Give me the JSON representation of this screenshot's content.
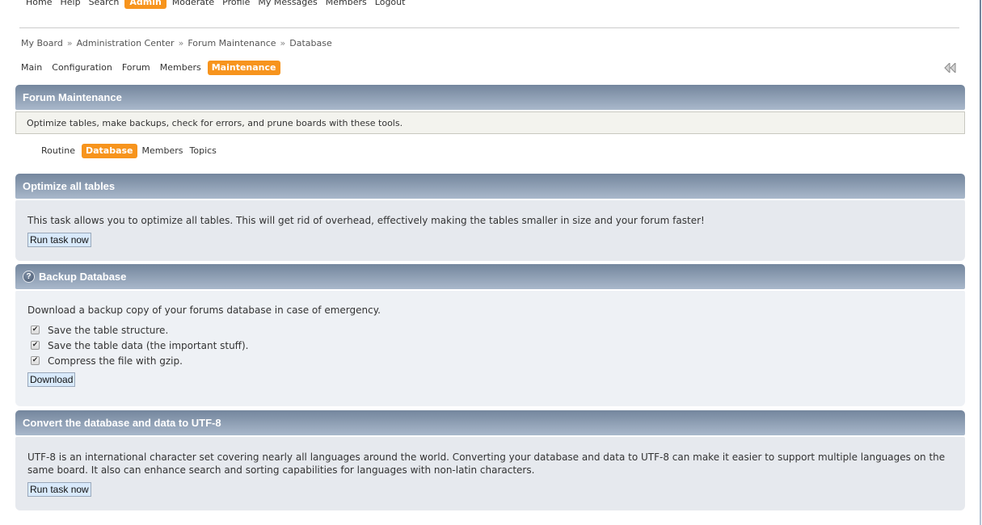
{
  "top_nav": {
    "items": [
      {
        "label": "Home",
        "active": false
      },
      {
        "label": "Help",
        "active": false
      },
      {
        "label": "Search",
        "active": false
      },
      {
        "label": "Admin",
        "active": true
      },
      {
        "label": "Moderate",
        "active": false
      },
      {
        "label": "Profile",
        "active": false
      },
      {
        "label": "My Messages",
        "active": false
      },
      {
        "label": "Members",
        "active": false
      },
      {
        "label": "Logout",
        "active": false
      }
    ]
  },
  "breadcrumb": {
    "separator": "»",
    "items": [
      "My Board",
      "Administration Center",
      "Forum Maintenance",
      "Database"
    ]
  },
  "admin_nav": {
    "items": [
      {
        "label": "Main",
        "active": false
      },
      {
        "label": "Configuration",
        "active": false
      },
      {
        "label": "Forum",
        "active": false
      },
      {
        "label": "Members",
        "active": false
      },
      {
        "label": "Maintenance",
        "active": true
      }
    ],
    "collapse_icon": "double-chevron-left-icon"
  },
  "section": {
    "title": "Forum Maintenance",
    "description": "Optimize tables, make backups, check for errors, and prune boards with these tools.",
    "tabs": [
      {
        "label": "Routine",
        "active": false
      },
      {
        "label": "Database",
        "active": true
      },
      {
        "label": "Members",
        "active": false
      },
      {
        "label": "Topics",
        "active": false
      }
    ]
  },
  "panels": {
    "optimize": {
      "title": "Optimize all tables",
      "text": "This task allows you to optimize all tables. This will get rid of overhead, effectively making the tables smaller in size and your forum faster!",
      "button": "Run task now"
    },
    "backup": {
      "title": "Backup Database",
      "help_icon": "?",
      "text": "Download a backup copy of your forums database in case of emergency.",
      "options": [
        {
          "label": "Save the table structure.",
          "checked": true
        },
        {
          "label": "Save the table data (the important stuff).",
          "checked": true
        },
        {
          "label": "Compress the file with gzip.",
          "checked": true
        }
      ],
      "button": "Download"
    },
    "utf8": {
      "title": "Convert the database and data to UTF-8",
      "text": "UTF-8 is an international character set covering nearly all languages around the world. Converting your database and data to UTF-8 can make it easier to support multiple languages on the same board. It also can enhance search and sorting capabilities for languages with non-latin characters.",
      "button": "Run task now"
    }
  },
  "colors": {
    "accent": "#f7941d",
    "header_bar_top": "#74869d",
    "header_bar_bottom": "#a9b8cb",
    "panel_bg": "#e6e9ee",
    "button_bg": "#d8e9fb"
  }
}
